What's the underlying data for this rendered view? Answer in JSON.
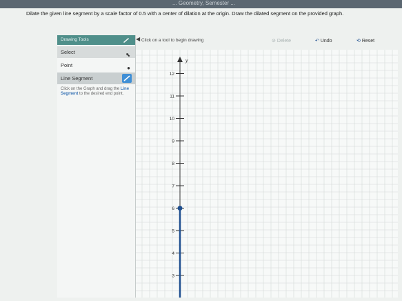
{
  "header": {
    "breadcrumb": "... Geometry, Semester ..."
  },
  "question": {
    "text": "Dilate the given line segment by a scale factor of 0.5 with a center of dilation at the origin. Draw the dilated segment on the provided graph."
  },
  "tool_panel": {
    "title": "Drawing Tools",
    "tools": [
      {
        "label": "Select",
        "icon": "select-arrow-icon"
      },
      {
        "label": "Point",
        "icon": "point-dot-icon"
      },
      {
        "label": "Line Segment",
        "icon": "line-segment-icon"
      }
    ],
    "instruction": "Click on the Graph and drag the Line Segment to the desired end point.",
    "instruction_parts": {
      "before": "Click on the Graph and drag the ",
      "bold": "Line Segment",
      "after": " to the desired end point."
    }
  },
  "toolbar": {
    "hint": "Click on a tool to begin drawing",
    "delete_label": "Delete",
    "undo_label": "Undo",
    "reset_label": "Reset"
  },
  "graph": {
    "axis_label_y": "y",
    "y_ticks": [
      "3",
      "4",
      "5",
      "6",
      "7",
      "8",
      "9",
      "10",
      "11",
      "12"
    ],
    "segment": {
      "from": [
        0,
        6
      ],
      "to": [
        0,
        2
      ]
    },
    "accent": "#1f4f8f"
  }
}
